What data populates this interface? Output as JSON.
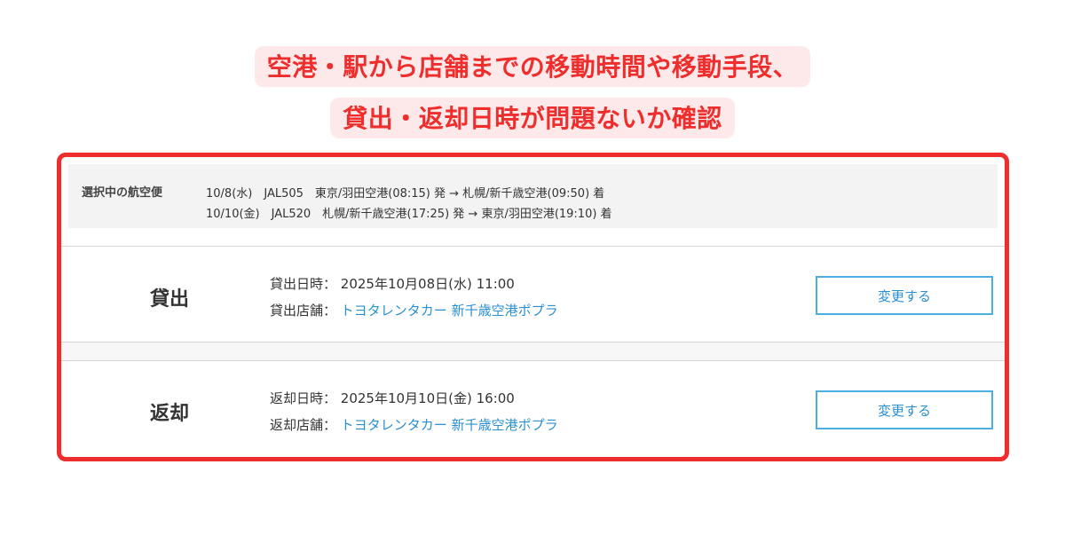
{
  "callout": {
    "line1": "空港・駅から店舗までの移動時間や移動手段、",
    "line2": "貸出・返却日時が問題ないか確認"
  },
  "flights": {
    "label": "選択中の航空便",
    "items": [
      "10/8(水)　JAL505　東京/羽田空港(08:15) 発 → 札幌/新千歳空港(09:50) 着",
      "10/10(金)　JAL520　札幌/新千歳空港(17:25) 発 → 東京/羽田空港(19:10) 着"
    ]
  },
  "rental": {
    "title": "貸出",
    "date_label": "貸出日時：",
    "date_value": "2025年10月08日(水) 11:00",
    "store_label": "貸出店舗：",
    "store_value": "トヨタレンタカー 新千歳空港ポプラ",
    "change_label": "変更する"
  },
  "return": {
    "title": "返却",
    "date_label": "返却日時：",
    "date_value": "2025年10月10日(金) 16:00",
    "store_label": "返却店舗：",
    "store_value": "トヨタレンタカー 新千歳空港ポプラ",
    "change_label": "変更する"
  },
  "colors": {
    "accent_red": "#ee2d2d",
    "callout_bg": "#fde9e9",
    "link_blue": "#2a8fd0",
    "button_border": "#4aaee0"
  }
}
